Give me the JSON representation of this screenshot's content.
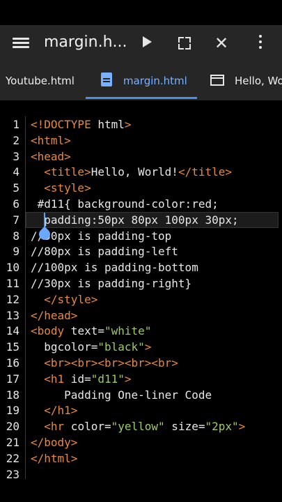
{
  "toolbar": {
    "title": "margin.h..."
  },
  "tabs": [
    {
      "label": "Youtube.html",
      "active": false
    },
    {
      "label": "margin.html",
      "active": true
    },
    {
      "label": "Hello, Wo",
      "active": false
    }
  ],
  "editor": {
    "line_numbers": [
      "1",
      "2",
      "3",
      "4",
      "5",
      "6",
      "7",
      "8",
      "9",
      "10",
      "11",
      "12",
      "13",
      "14",
      "15",
      "16",
      "17",
      "18",
      "19",
      "20",
      "21",
      "22",
      "23"
    ],
    "lines": [
      {
        "parts": [
          {
            "t": "tag",
            "v": "<!DOCTYPE"
          },
          {
            "t": "txt",
            "v": " html"
          },
          {
            "t": "tag",
            "v": ">"
          }
        ]
      },
      {
        "parts": [
          {
            "t": "tag",
            "v": "<html>"
          }
        ]
      },
      {
        "parts": [
          {
            "t": "tag",
            "v": "<head>"
          }
        ]
      },
      {
        "parts": [
          {
            "t": "txt",
            "v": "  "
          },
          {
            "t": "tag",
            "v": "<title>"
          },
          {
            "t": "txt",
            "v": "Hello, World!"
          },
          {
            "t": "tag",
            "v": "</title>"
          }
        ]
      },
      {
        "parts": [
          {
            "t": "txt",
            "v": "  "
          },
          {
            "t": "tag",
            "v": "<style>"
          }
        ]
      },
      {
        "parts": [
          {
            "t": "txt",
            "v": " #d11{ background-color:red;"
          }
        ]
      },
      {
        "parts": [
          {
            "t": "txt",
            "v": "  padding:50px 80px 100px 30px;"
          }
        ]
      },
      {
        "parts": [
          {
            "t": "txt",
            "v": "//50px is padding-top"
          }
        ]
      },
      {
        "parts": [
          {
            "t": "txt",
            "v": "//80px is padding-left"
          }
        ]
      },
      {
        "parts": [
          {
            "t": "txt",
            "v": "//100px is padding-bottom"
          }
        ]
      },
      {
        "parts": [
          {
            "t": "txt",
            "v": "//30px is padding-right}"
          }
        ]
      },
      {
        "parts": [
          {
            "t": "txt",
            "v": "  "
          },
          {
            "t": "tag",
            "v": "</style>"
          }
        ]
      },
      {
        "parts": [
          {
            "t": "tag",
            "v": "</head>"
          }
        ]
      },
      {
        "parts": [
          {
            "t": "tag",
            "v": "<body"
          },
          {
            "t": "attr",
            "v": " text="
          },
          {
            "t": "str",
            "v": "\"white\""
          }
        ]
      },
      {
        "parts": [
          {
            "t": "attr",
            "v": "  bgcolor="
          },
          {
            "t": "str",
            "v": "\"black\""
          },
          {
            "t": "tag",
            "v": ">"
          }
        ]
      },
      {
        "parts": [
          {
            "t": "txt",
            "v": "  "
          },
          {
            "t": "tag",
            "v": "<br><br><br><br><br>"
          }
        ]
      },
      {
        "parts": [
          {
            "t": "txt",
            "v": "  "
          },
          {
            "t": "tag",
            "v": "<h1"
          },
          {
            "t": "attr",
            "v": " id="
          },
          {
            "t": "str",
            "v": "\"d11\""
          },
          {
            "t": "tag",
            "v": ">"
          }
        ]
      },
      {
        "parts": [
          {
            "t": "txt",
            "v": "     Padding One-liner Code"
          }
        ]
      },
      {
        "parts": [
          {
            "t": "txt",
            "v": "  "
          },
          {
            "t": "tag",
            "v": "</h1>"
          }
        ]
      },
      {
        "parts": [
          {
            "t": "txt",
            "v": "  "
          },
          {
            "t": "tag",
            "v": "<hr"
          },
          {
            "t": "attr",
            "v": " color="
          },
          {
            "t": "str",
            "v": "\"yellow\""
          },
          {
            "t": "attr",
            "v": " size="
          },
          {
            "t": "str",
            "v": "\"2px\""
          },
          {
            "t": "tag",
            "v": ">"
          }
        ]
      },
      {
        "parts": [
          {
            "t": "tag",
            "v": "</body>"
          }
        ]
      },
      {
        "parts": [
          {
            "t": "tag",
            "v": "</html>"
          }
        ]
      },
      {
        "parts": []
      }
    ]
  },
  "colors": {
    "tag": "#e8893e",
    "string": "#9ccc65",
    "accent": "#7ab1ff",
    "bar_bg": "#262626"
  },
  "icons": [
    "menu-icon",
    "play-icon",
    "fullscreen-icon",
    "close-icon",
    "more-vert-icon",
    "file-icon",
    "window-icon"
  ]
}
